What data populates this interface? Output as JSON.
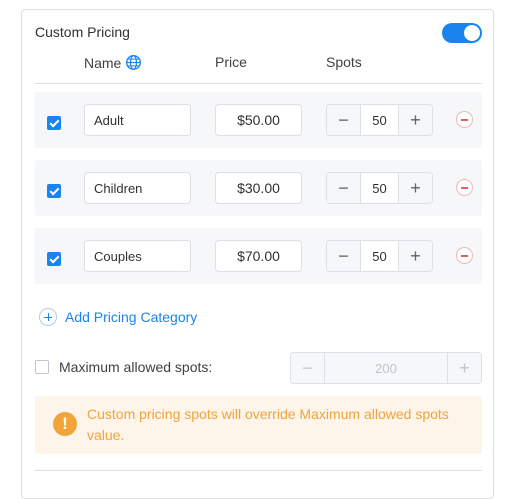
{
  "section": {
    "title": "Custom Pricing",
    "toggle_on": true
  },
  "columns": {
    "name": "Name",
    "price": "Price",
    "spots": "Spots"
  },
  "rows": [
    {
      "checked": true,
      "name": "Adult",
      "price": "$50.00",
      "spots": "50"
    },
    {
      "checked": true,
      "name": "Children",
      "price": "$30.00",
      "spots": "50"
    },
    {
      "checked": true,
      "name": "Couples",
      "price": "$70.00",
      "spots": "50"
    }
  ],
  "add_category": {
    "label": "Add Pricing Category"
  },
  "max_spots": {
    "checked": false,
    "label": "Maximum allowed spots:",
    "value": "200"
  },
  "warning": {
    "text": "Custom pricing spots will override Maximum allowed spots value."
  },
  "icons": {
    "globe": "globe-icon",
    "minus": "minus-icon",
    "plus": "plus-icon",
    "remove": "remove-circle-icon",
    "add": "plus-circle-icon",
    "warning": "exclamation-icon"
  },
  "colors": {
    "accent": "#1a84ee",
    "warning": "#f2a33a",
    "warning_bg": "#fdf4ea",
    "danger": "#ee5a5a"
  }
}
